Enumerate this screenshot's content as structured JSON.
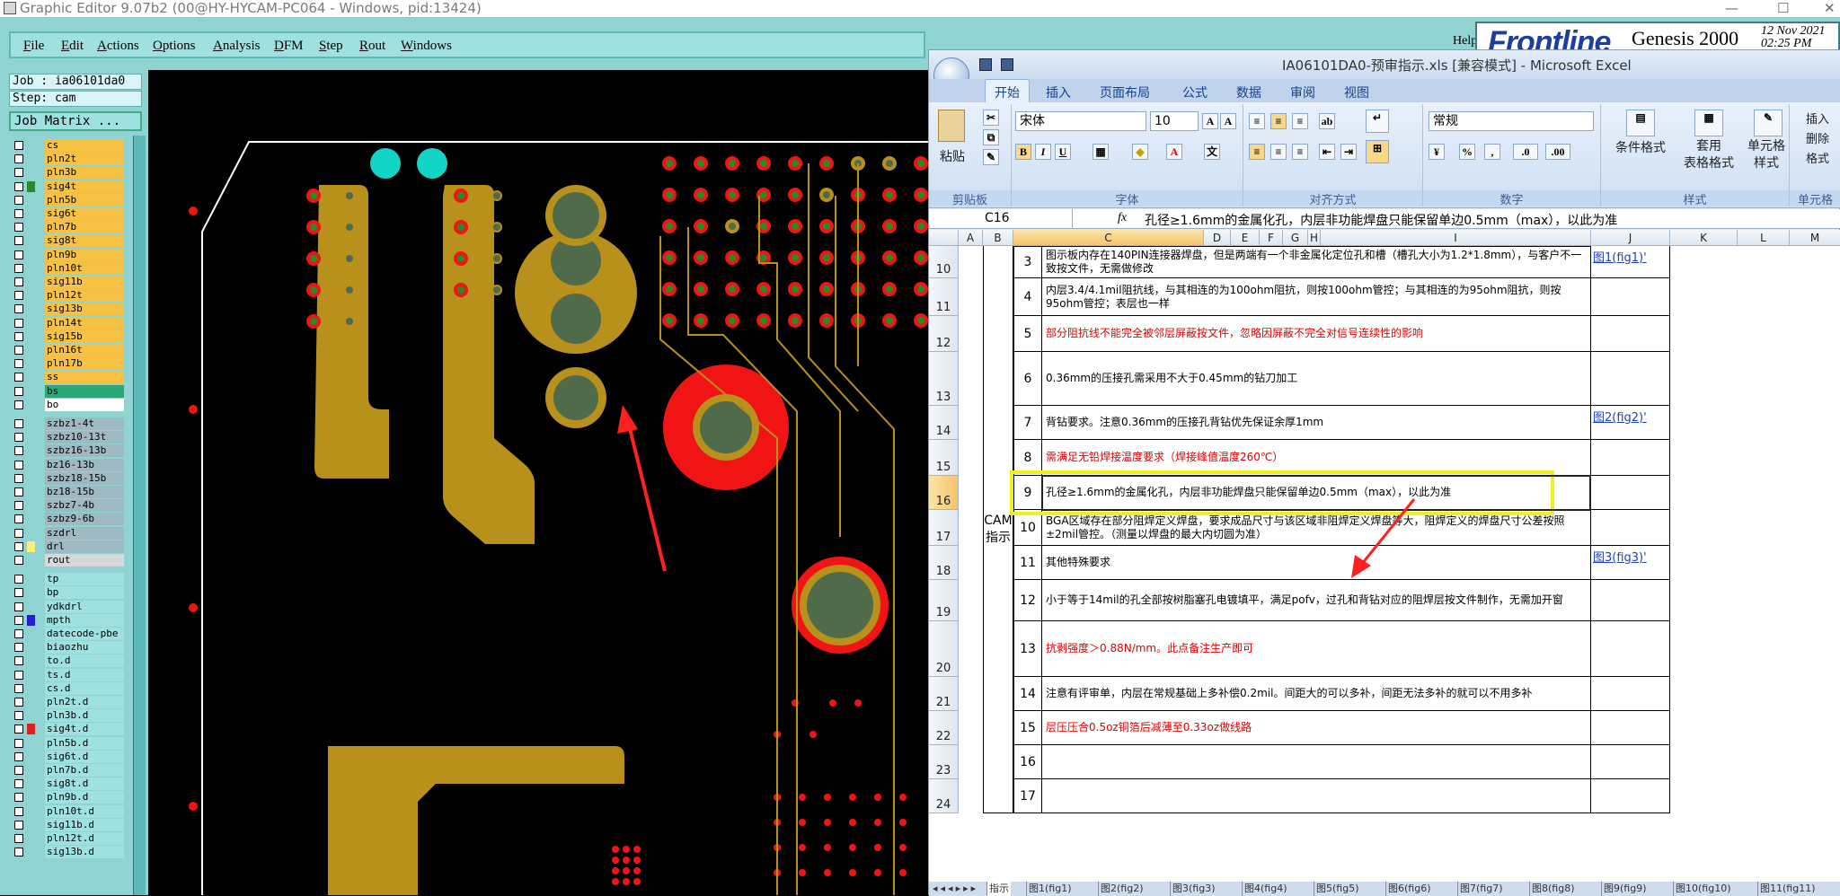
{
  "genesis": {
    "title": "Graphic Editor 9.07b2 (00@HY-HYCAM-PC064 - Windows, pid:13424)",
    "window_controls": [
      "—",
      "☐",
      "✕"
    ],
    "menu": [
      "File",
      "Edit",
      "Actions",
      "Options",
      "Analysis",
      "DFM",
      "Step",
      "Rout",
      "Windows"
    ],
    "help": "Help",
    "brand": {
      "frontline": "Frontline",
      "product": "Genesis 2000",
      "date": "12 Nov 2021",
      "time": "02:25 PM"
    },
    "job": "Job : ia06101da0",
    "step": "Step: cam",
    "job_matrix": "Job Matrix ...",
    "layers": [
      {
        "name": "cs",
        "bg": "#f7c244",
        "mark": ""
      },
      {
        "name": "pln2t",
        "bg": "#f7c244",
        "mark": ""
      },
      {
        "name": "pln3b",
        "bg": "#f7c244",
        "mark": ""
      },
      {
        "name": "sig4t",
        "bg": "#f7c244",
        "mark": "#2a8a2a"
      },
      {
        "name": "pln5b",
        "bg": "#f7c244",
        "mark": ""
      },
      {
        "name": "sig6t",
        "bg": "#f7c244",
        "mark": ""
      },
      {
        "name": "pln7b",
        "bg": "#f7c244",
        "mark": ""
      },
      {
        "name": "sig8t",
        "bg": "#f7c244",
        "mark": ""
      },
      {
        "name": "pln9b",
        "bg": "#f7c244",
        "mark": ""
      },
      {
        "name": "pln10t",
        "bg": "#f7c244",
        "mark": ""
      },
      {
        "name": "sig11b",
        "bg": "#f7c244",
        "mark": ""
      },
      {
        "name": "pln12t",
        "bg": "#f7c244",
        "mark": ""
      },
      {
        "name": "sig13b",
        "bg": "#f7c244",
        "mark": ""
      },
      {
        "name": "pln14t",
        "bg": "#f7c244",
        "mark": ""
      },
      {
        "name": "sig15b",
        "bg": "#f7c244",
        "mark": ""
      },
      {
        "name": "pln16t",
        "bg": "#f7c244",
        "mark": ""
      },
      {
        "name": "pln17b",
        "bg": "#f7c244",
        "mark": ""
      },
      {
        "name": "ss",
        "bg": "#f7c244",
        "mark": ""
      },
      {
        "name": "bs",
        "bg": "#2aa878",
        "mark": ""
      },
      {
        "name": "bo",
        "bg": "#ffffff",
        "mark": ""
      },
      {
        "name": "szbz1-4t",
        "bg": "#9fb9c3",
        "mark": ""
      },
      {
        "name": "szbz10-13t",
        "bg": "#9fb9c3",
        "mark": ""
      },
      {
        "name": "szbz16-13b",
        "bg": "#9fb9c3",
        "mark": ""
      },
      {
        "name": "bz16-13b",
        "bg": "#9fb9c3",
        "mark": ""
      },
      {
        "name": "szbz18-15b",
        "bg": "#9fb9c3",
        "mark": ""
      },
      {
        "name": "bz18-15b",
        "bg": "#9fb9c3",
        "mark": ""
      },
      {
        "name": "szbz7-4b",
        "bg": "#9fb9c3",
        "mark": ""
      },
      {
        "name": "szbz9-6b",
        "bg": "#9fb9c3",
        "mark": ""
      },
      {
        "name": "szdrl",
        "bg": "#9fb9c3",
        "mark": ""
      },
      {
        "name": "drl",
        "bg": "#9fb9c3",
        "mark": "#f7f07a"
      },
      {
        "name": "rout",
        "bg": "#d8d8d8",
        "mark": ""
      },
      {
        "name": "tp",
        "bg": "#9fe0e0",
        "mark": ""
      },
      {
        "name": "bp",
        "bg": "#9fe0e0",
        "mark": ""
      },
      {
        "name": "ydkdrl",
        "bg": "#9fe0e0",
        "mark": ""
      },
      {
        "name": "mpth",
        "bg": "#9fe0e0",
        "mark": "#2020d0"
      },
      {
        "name": "datecode-pbe",
        "bg": "#9fe0e0",
        "mark": ""
      },
      {
        "name": "biaozhu",
        "bg": "#9fe0e0",
        "mark": ""
      },
      {
        "name": "to.d",
        "bg": "#9fe0e0",
        "mark": ""
      },
      {
        "name": "ts.d",
        "bg": "#9fe0e0",
        "mark": ""
      },
      {
        "name": "cs.d",
        "bg": "#9fe0e0",
        "mark": ""
      },
      {
        "name": "pln2t.d",
        "bg": "#9fe0e0",
        "mark": ""
      },
      {
        "name": "pln3b.d",
        "bg": "#9fe0e0",
        "mark": ""
      },
      {
        "name": "sig4t.d",
        "bg": "#9fe0e0",
        "mark": "#e02020"
      },
      {
        "name": "pln5b.d",
        "bg": "#9fe0e0",
        "mark": ""
      },
      {
        "name": "sig6t.d",
        "bg": "#9fe0e0",
        "mark": ""
      },
      {
        "name": "pln7b.d",
        "bg": "#9fe0e0",
        "mark": ""
      },
      {
        "name": "sig8t.d",
        "bg": "#9fe0e0",
        "mark": ""
      },
      {
        "name": "pln9b.d",
        "bg": "#9fe0e0",
        "mark": ""
      },
      {
        "name": "pln10t.d",
        "bg": "#9fe0e0",
        "mark": ""
      },
      {
        "name": "sig11b.d",
        "bg": "#9fe0e0",
        "mark": ""
      },
      {
        "name": "pln12t.d",
        "bg": "#9fe0e0",
        "mark": ""
      },
      {
        "name": "sig13b.d",
        "bg": "#9fe0e0",
        "mark": ""
      }
    ]
  },
  "excel": {
    "title": "IA06101DA0-预审指示.xls  [兼容模式] - Microsoft Excel",
    "tabs": [
      "开始",
      "插入",
      "页面布局",
      "公式",
      "数据",
      "审阅",
      "视图"
    ],
    "ribbon": {
      "paste": "粘贴",
      "clipboard": "剪贴板",
      "font_name": "宋体",
      "font_size": "10",
      "font_group": "字体",
      "align_group": "对齐方式",
      "number_format": "常规",
      "number_group": "数字",
      "cond_format": "条件格式",
      "table_format": "套用\n表格格式",
      "cell_style": "单元格\n样式",
      "styles_group": "样式",
      "insert": "插入",
      "delete": "删除",
      "format": "格式",
      "cells_group": "单元格",
      "bold": "B",
      "italic": "I",
      "underline": "U"
    },
    "name_box": "C16",
    "fx": "fx",
    "formula": "孔径≥1.6mm的金属化孔，内层非功能焊盘只能保留单边0.5mm（max），以此为准",
    "columns": [
      "A",
      "B",
      "C",
      "D",
      "E",
      "F",
      "G",
      "H",
      "I",
      "J",
      "K",
      "L",
      "M"
    ],
    "category": "CAM\n指示",
    "rows": [
      {
        "row_nums": [
          "10"
        ],
        "num": "3",
        "text": "图示板内存在140PIN连接器焊盘，但是两端有一个非金属化定位孔和槽（槽孔大小为1.2*1.8mm），与客户不一致按文件，无需做修改",
        "red": false,
        "link": "图1(fig1)'"
      },
      {
        "row_nums": [
          "11"
        ],
        "num": "4",
        "text": "内层3.4/4.1mil阻抗线，与其相连的为100ohm阻抗，则按100ohm管控；与其相连的为95ohm阻抗，则按95ohm管控；表层也一样",
        "red": false,
        "link": ""
      },
      {
        "row_nums": [
          "12"
        ],
        "num": "5",
        "text": "部分阻抗线不能完全被邻层屏蔽按文件，忽略因屏蔽不完全对信号连续性的影响",
        "red": true,
        "link": ""
      },
      {
        "row_nums": [
          "13"
        ],
        "num": "6",
        "text": "0.36mm的压接孔需采用不大于0.45mm的钻刀加工",
        "red": false,
        "link": ""
      },
      {
        "row_nums": [
          "14"
        ],
        "num": "7",
        "text": "背钻要求。注意0.36mm的压接孔背钻优先保证余厚1mm",
        "red": false,
        "link": "图2(fig2)'"
      },
      {
        "row_nums": [
          "15"
        ],
        "num": "8",
        "text": "需满足无铅焊接温度要求（焊接峰值温度260℃）",
        "red": true,
        "link": ""
      },
      {
        "row_nums": [
          "16"
        ],
        "num": "9",
        "text": "孔径≥1.6mm的金属化孔，内层非功能焊盘只能保留单边0.5mm（max），以此为准",
        "red": false,
        "link": ""
      },
      {
        "row_nums": [
          "17"
        ],
        "num": "10",
        "text": "BGA区域存在部分阻焊定义焊盘，要求成品尺寸与该区域非阻焊定义焊盘等大，阻焊定义的焊盘尺寸公差按照±2mil管控。（测量以焊盘的最大内切圆为准）",
        "red": false,
        "link": ""
      },
      {
        "row_nums": [
          "18"
        ],
        "num": "11",
        "text": "其他特殊要求",
        "red": false,
        "link": "图3(fig3)'"
      },
      {
        "row_nums": [
          "19"
        ],
        "num": "12",
        "text": "小于等于14mil的孔全部按树脂塞孔电镀填平，满足pofv，过孔和背钻对应的阻焊层按文件制作，无需加开窗",
        "red": false,
        "link": ""
      },
      {
        "row_nums": [
          "20"
        ],
        "num": "13",
        "text": "抗剥强度＞0.88N/mm。此点备注生产即可",
        "red": true,
        "link": ""
      },
      {
        "row_nums": [
          "21"
        ],
        "num": "14",
        "text": "注意有评审单，内层在常规基础上多补偿0.2mil。间距大的可以多补，间距无法多补的就可以不用多补",
        "red": false,
        "link": ""
      },
      {
        "row_nums": [
          "22"
        ],
        "num": "15",
        "text": "层压压合0.5oz铜箔后减薄至0.33oz做线路",
        "red": true,
        "link": ""
      },
      {
        "row_nums": [
          "23"
        ],
        "num": "16",
        "text": "",
        "red": false,
        "link": ""
      },
      {
        "row_nums": [
          "24"
        ],
        "num": "17",
        "text": "",
        "red": false,
        "link": ""
      }
    ],
    "sheet_tabs": [
      "指示",
      "图1(fig1)",
      "图2(fig2)",
      "图3(fig3)",
      "图4(fig4)",
      "图5(fig5)",
      "图6(fig6)",
      "图7(fig7)",
      "图8(fig8)",
      "图9(fig9)",
      "图10(fig10)",
      "图11(fig11)"
    ],
    "sheet_nav": "◂◂◂▸▸▸"
  }
}
